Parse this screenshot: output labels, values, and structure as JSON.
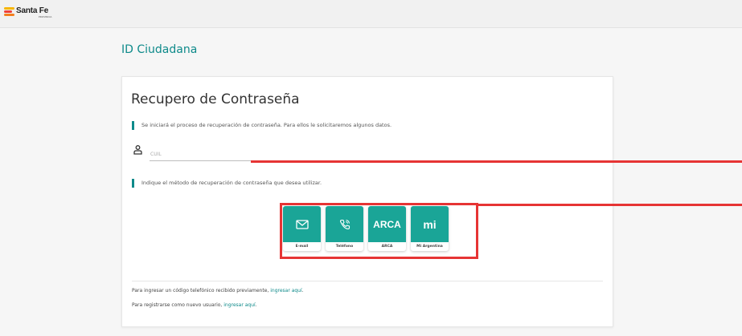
{
  "header": {
    "logo_title": "Santa Fe",
    "logo_subtitle": "PROVINCIA"
  },
  "page_title": "ID Ciudadana",
  "card": {
    "title": "Recupero de Contraseña",
    "info_start": "Se iniciará el proceso de recuperación de contraseña. Para ellos le solicitaremos algunos datos.",
    "cuil_placeholder": "CUIL",
    "info_method": "Indique el método de recuperación de contraseña que desea utilizar.",
    "methods": [
      {
        "label": "E-mail",
        "icon": "envelope-icon"
      },
      {
        "label": "Teléfono",
        "icon": "phone-icon"
      },
      {
        "label": "ARCA",
        "tile_text": "ARCA"
      },
      {
        "label": "Mi Argentina",
        "tile_text": "mi"
      }
    ],
    "footer": {
      "line1_text": "Para ingresar un código telefónico recibido previamente, ",
      "line1_link": "ingresar aquí",
      "line1_end": ".",
      "line2_text": "Para registrarse como nuevo usuario, ",
      "line2_link": "ingresar aquí",
      "line2_end": "."
    }
  },
  "colors": {
    "accent": "#0e8a8a",
    "tile": "#1aa597",
    "highlight": "#e63434"
  }
}
